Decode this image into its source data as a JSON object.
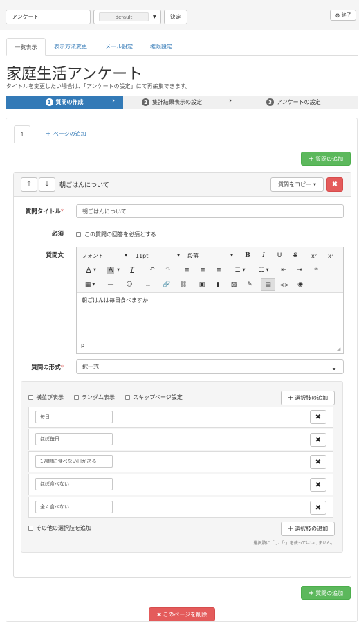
{
  "header": {
    "title_input": "アンケート",
    "select_value": "default",
    "decide_label": "決定",
    "exit_label": "終了"
  },
  "tabs": [
    {
      "label": "一覧表示"
    },
    {
      "label": "表示方法変更"
    },
    {
      "label": "メール設定"
    },
    {
      "label": "権限設定"
    }
  ],
  "page_title": "家庭生活アンケート",
  "subtitle": "タイトルを変更したい場合は、「アンケートの設定」にて再編集できます。",
  "steps": [
    {
      "num": "1",
      "label": "質問の作成"
    },
    {
      "num": "2",
      "label": "集計結果表示の設定"
    },
    {
      "num": "3",
      "label": "アンケートの設定"
    }
  ],
  "page_tabs": {
    "page1": "1",
    "add_page": "ページの追加"
  },
  "add_question_label": "質問の追加",
  "question": {
    "heading": "朝ごはんについて",
    "copy_label": "質問をコピー",
    "title_label": "質問タイトル",
    "required_mark": "*",
    "title_value": "朝ごはんについて",
    "required_label": "必須",
    "required_checkbox_label": "この質問の回答を必須とする",
    "body_label": "質問文",
    "editor": {
      "font": "フォント",
      "size": "11pt",
      "paragraph": "段落",
      "content": "朝ごはんは毎日食べますか",
      "status": "p"
    },
    "type_label": "質問の形式",
    "type_value": "択一式"
  },
  "options_panel": {
    "horizontal_label": "横並び表示",
    "random_label": "ランダム表示",
    "skip_label": "スキップページ設定",
    "add_option_label": "選択肢の追加",
    "options": [
      "毎日",
      "ほぼ毎日",
      "1週間に食べない日がある",
      "ほぼ食べない",
      "全く食べない"
    ],
    "other_label": "その他の選択肢を追加",
    "note": "選択肢に「|」、「:」を使ってはいけません。"
  },
  "delete_page_label": "このページを削除",
  "colors": {
    "step_active": "#337ab7",
    "green": "#5cb85c",
    "red": "#e45b5b"
  }
}
